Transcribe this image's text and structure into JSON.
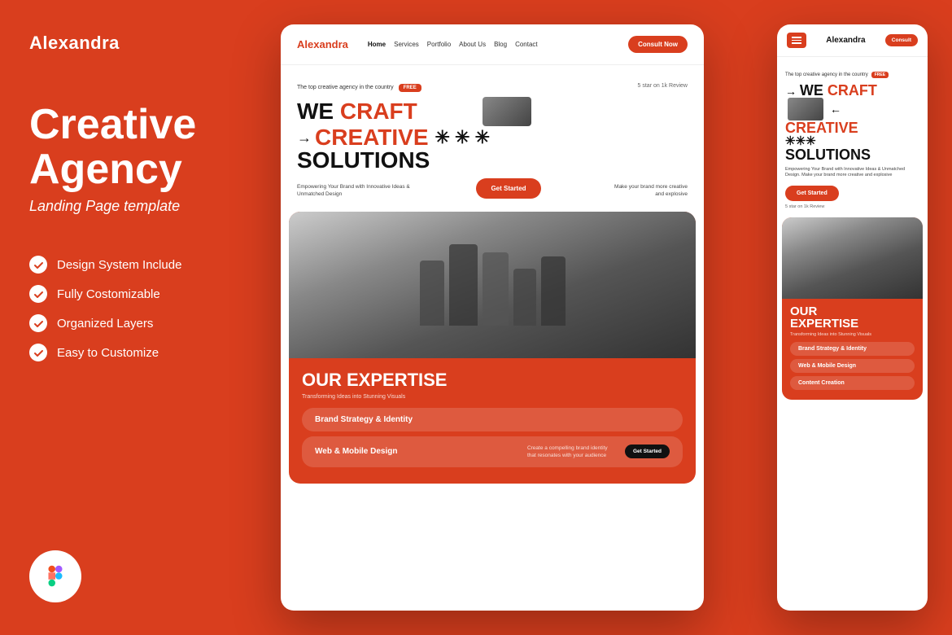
{
  "left": {
    "brand": "Alexandra",
    "title_line1": "Creative",
    "title_line2": "Agency",
    "subtitle": "Landing Page template",
    "features": [
      {
        "label": "Design System Include"
      },
      {
        "label": "Fully Costomizable"
      },
      {
        "label": "Organized Layers"
      },
      {
        "label": "Easy to Customize"
      }
    ]
  },
  "desktop": {
    "nav": {
      "logo": "Alexandra",
      "links": [
        "Home",
        "Services",
        "Portfolio",
        "About Us",
        "Blog",
        "Contact"
      ],
      "cta": "Consult Now"
    },
    "hero": {
      "badge_text": "The top creative agency in the country",
      "badge_free": "FREE",
      "star_text": "5 star on 1k Review",
      "headline_1": "WE CRAFT",
      "headline_2": "CREATIVE",
      "headline_3": "SOLUTIONS",
      "tagline": "Empowering Your Brand with Innovative Ideas & Unmatched Design",
      "cta": "Get Started",
      "make_brand": "Make your brand more creative and explosive"
    },
    "expertise": {
      "title": "OUR EXPERTISE",
      "subtitle": "Transforming Ideas into Stunning Visuals",
      "services": [
        {
          "name": "Brand Strategy & Identity",
          "desc": "",
          "has_btn": false
        },
        {
          "name": "Web & Mobile Design",
          "desc": "Create a compelling brand identity that resonates with your audience",
          "btn": "Get Started",
          "has_btn": true
        }
      ]
    }
  },
  "mobile": {
    "nav": {
      "logo": "Alexandra",
      "cta": "Consult"
    },
    "hero": {
      "badge_text": "The top creative agency in the country",
      "badge_free": "FREE",
      "headline_1": "WE CRAFT",
      "headline_2": "CREATIVE",
      "headline_3": "SOLUTIONS",
      "tagline": "Empowering Your Brand with Innovative Ideas & Unmatched Design. Make your brand more creative and explosive",
      "cta": "Get Started",
      "star_text": "5 star on 1k Review"
    },
    "expertise": {
      "title_line1": "OUR",
      "title_line2": "EXPERTISE",
      "subtitle": "Transforming Ideas into Stunning Visuals",
      "services": [
        {
          "name": "Brand Strategy & Identity"
        },
        {
          "name": "Web & Mobile Design"
        },
        {
          "name": "Content Creation"
        }
      ]
    }
  },
  "colors": {
    "primary": "#D93E1E",
    "dark": "#111111",
    "white": "#FFFFFF"
  }
}
